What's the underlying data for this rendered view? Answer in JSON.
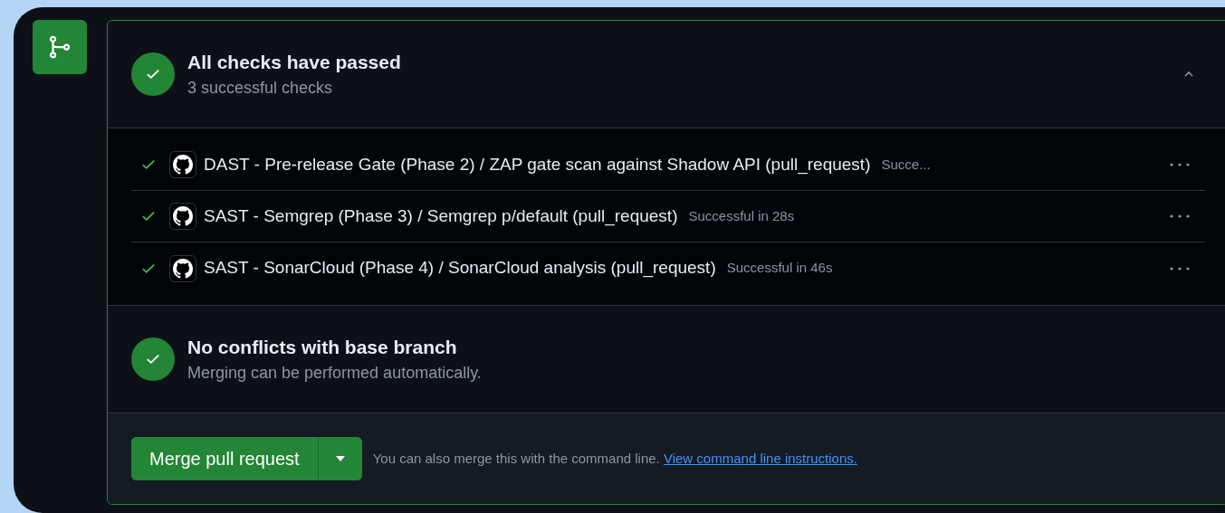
{
  "checks_summary": {
    "title": "All checks have passed",
    "subtitle": "3 successful checks",
    "expanded": true
  },
  "checks": [
    {
      "name": "DAST - Pre-release Gate (Phase 2) / ZAP gate scan against Shadow API (pull_request)",
      "status": "Succe..."
    },
    {
      "name": "SAST - Semgrep (Phase 3) / Semgrep p/default (pull_request)",
      "status": "Successful in 28s"
    },
    {
      "name": "SAST - SonarCloud (Phase 4) / SonarCloud analysis (pull_request)",
      "status": "Successful in 46s"
    }
  ],
  "conflicts": {
    "title": "No conflicts with base branch",
    "subtitle": "Merging can be performed automatically."
  },
  "merge": {
    "button": "Merge pull request",
    "hint": "You can also merge this with the command line.",
    "link": "View command line instructions."
  }
}
